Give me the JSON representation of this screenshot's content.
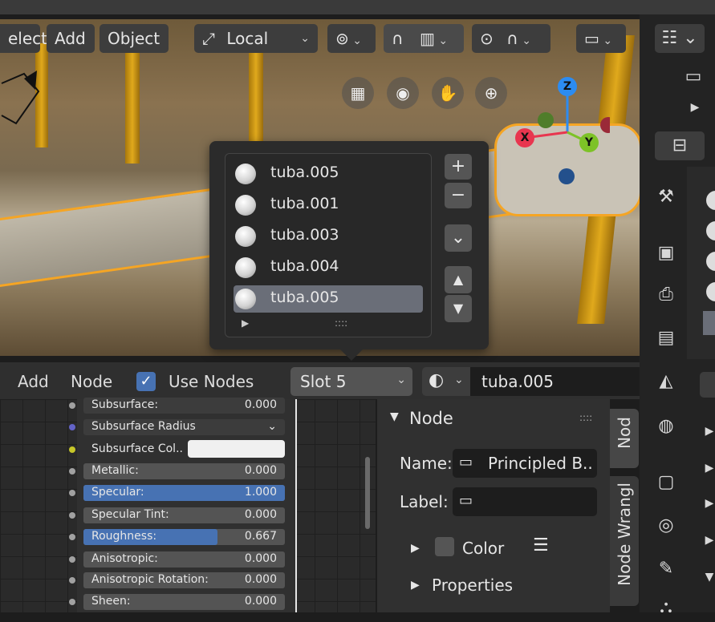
{
  "header": {
    "select_menu": "elect",
    "add_menu": "Add",
    "object_menu": "Object",
    "transform_orientation": "Local"
  },
  "viewport_gizmo": {
    "z_label": "Z",
    "x_label": "X",
    "y_label": "Y"
  },
  "material_popup": {
    "items": [
      {
        "label": "tuba.005",
        "selected": false
      },
      {
        "label": "tuba.001",
        "selected": false
      },
      {
        "label": "tuba.003",
        "selected": false
      },
      {
        "label": "tuba.004",
        "selected": false
      },
      {
        "label": "tuba.005",
        "selected": true
      }
    ],
    "add_symbol": "+",
    "remove_symbol": "−",
    "specials_symbol": "⌄",
    "up_symbol": "▲",
    "down_symbol": "▼",
    "expand_symbol": "▶",
    "grip_symbol": "::::"
  },
  "shader_header": {
    "add_menu": "Add",
    "node_menu": "Node",
    "use_nodes_label": "Use Nodes",
    "use_nodes_checked": true,
    "slot_value": "Slot 5",
    "material_name": "tuba.005"
  },
  "node_properties": [
    {
      "label": "Subsurface:",
      "value": "0.000",
      "fill": 0
    },
    {
      "label": "Subsurface Radius",
      "value": "",
      "fill": 0
    },
    {
      "label": "Subsurface Col..",
      "value": "",
      "fill": 0
    },
    {
      "label": "Metallic:",
      "value": "0.000",
      "fill": 0
    },
    {
      "label": "Specular:",
      "value": "1.000",
      "fill": 1.0
    },
    {
      "label": "Specular Tint:",
      "value": "0.000",
      "fill": 0
    },
    {
      "label": "Roughness:",
      "value": "0.667",
      "fill": 0.667
    },
    {
      "label": "Anisotropic:",
      "value": "0.000",
      "fill": 0
    },
    {
      "label": "Anisotropic Rotation:",
      "value": "0.000",
      "fill": 0
    },
    {
      "label": "Sheen:",
      "value": "0.000",
      "fill": 0
    }
  ],
  "n_panel": {
    "section_title": "Node",
    "name_label": "Name:",
    "name_value": "Principled B..",
    "label_label": "Label:",
    "label_value": "",
    "color_label": "Color",
    "properties_label": "Properties",
    "tab_node": "Nod",
    "tab_wrangler": "Node Wrangl"
  },
  "colors": {
    "accent_blue": "#4772b3",
    "selection_orange": "#f5a524",
    "axis_x": "#e8364f",
    "axis_y": "#7dc227",
    "axis_z": "#2c8cf2"
  }
}
